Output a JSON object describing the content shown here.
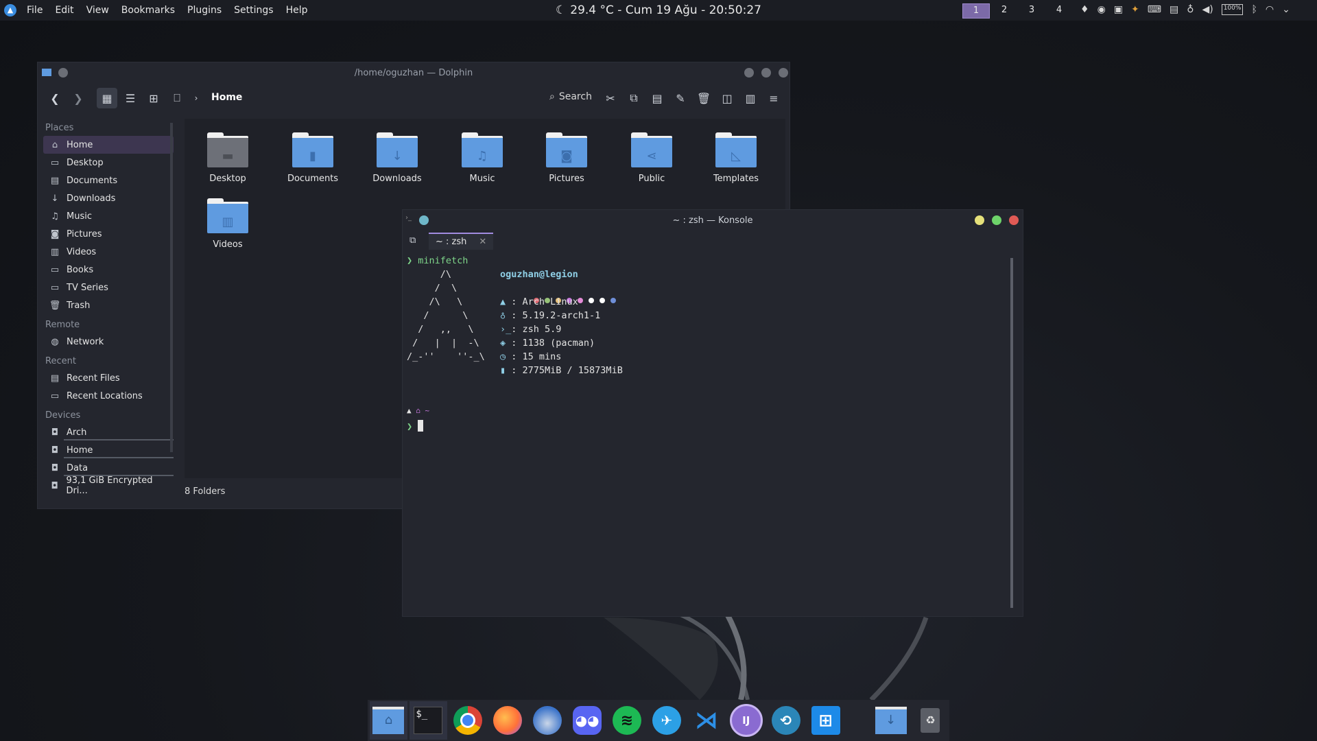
{
  "top_panel": {
    "menu": [
      "File",
      "Edit",
      "View",
      "Bookmarks",
      "Plugins",
      "Settings",
      "Help"
    ],
    "clock": "29.4 °C - Cum 19 Ağu - 20:50:27",
    "desktops": [
      "1",
      "2",
      "3",
      "4"
    ],
    "active_desktop": "1",
    "tray_icons": [
      "drop-icon",
      "record-icon",
      "clipboard-icon",
      "color-icon",
      "terminal-icon",
      "notes-icon",
      "bulb-icon",
      "volume-icon",
      "battery-icon",
      "bluetooth-icon",
      "wifi-icon",
      "chevron-down-icon"
    ],
    "battery_label": "100%"
  },
  "dolphin": {
    "title": "/home/oguzhan — Dolphin",
    "breadcrumb": "Home",
    "search_label": "Search",
    "sidebar": {
      "places_heading": "Places",
      "places": [
        "Home",
        "Desktop",
        "Documents",
        "Downloads",
        "Music",
        "Pictures",
        "Videos",
        "Books",
        "TV Series",
        "Trash"
      ],
      "remote_heading": "Remote",
      "remote": [
        "Network"
      ],
      "recent_heading": "Recent",
      "recent": [
        "Recent Files",
        "Recent Locations"
      ],
      "devices_heading": "Devices",
      "devices": [
        "Arch",
        "Home",
        "Data",
        "93,1 GiB Encrypted Dri..."
      ]
    },
    "folders": [
      "Desktop",
      "Documents",
      "Downloads",
      "Music",
      "Pictures",
      "Public",
      "Templates",
      "Videos"
    ],
    "status": "8 Folders"
  },
  "konsole": {
    "title": "~ : zsh — Konsole",
    "tab_label": "~ : zsh",
    "command": "minifetch",
    "user_host": "oguzhan@legion",
    "ascii_art": [
      "      /\\",
      "     /  \\",
      "    /\\   \\",
      "   /      \\",
      "  /   ,,   \\",
      " /   |  |  -\\",
      "/_-''    ''-_\\"
    ],
    "info": [
      ": Arch Linux",
      ": 5.19.2-arch1-1",
      ": zsh 5.9",
      ": 1138 (pacman)",
      ": 15 mins",
      ": 2775MiB / 15873MiB"
    ],
    "info_icons": [
      "arch-icon",
      "kernel-icon",
      "shell-icon",
      "package-icon",
      "clock-icon",
      "memory-icon"
    ],
    "color_dots": [
      "#e06c75",
      "#98c379",
      "#e5c07b",
      "#c678dd",
      "#e38bd6",
      "#ffffff",
      "#ffffff",
      "#6f8fd8"
    ],
    "prompt_path": "~"
  },
  "dock": {
    "apps": [
      "Home Folder",
      "Terminal",
      "Chrome",
      "Firefox",
      "Thunderbird",
      "Discord",
      "Spotify",
      "qBittorrent",
      "VS Code",
      "IntelliJ",
      "Shutter",
      "Windows",
      "Downloads",
      "Trash"
    ]
  }
}
